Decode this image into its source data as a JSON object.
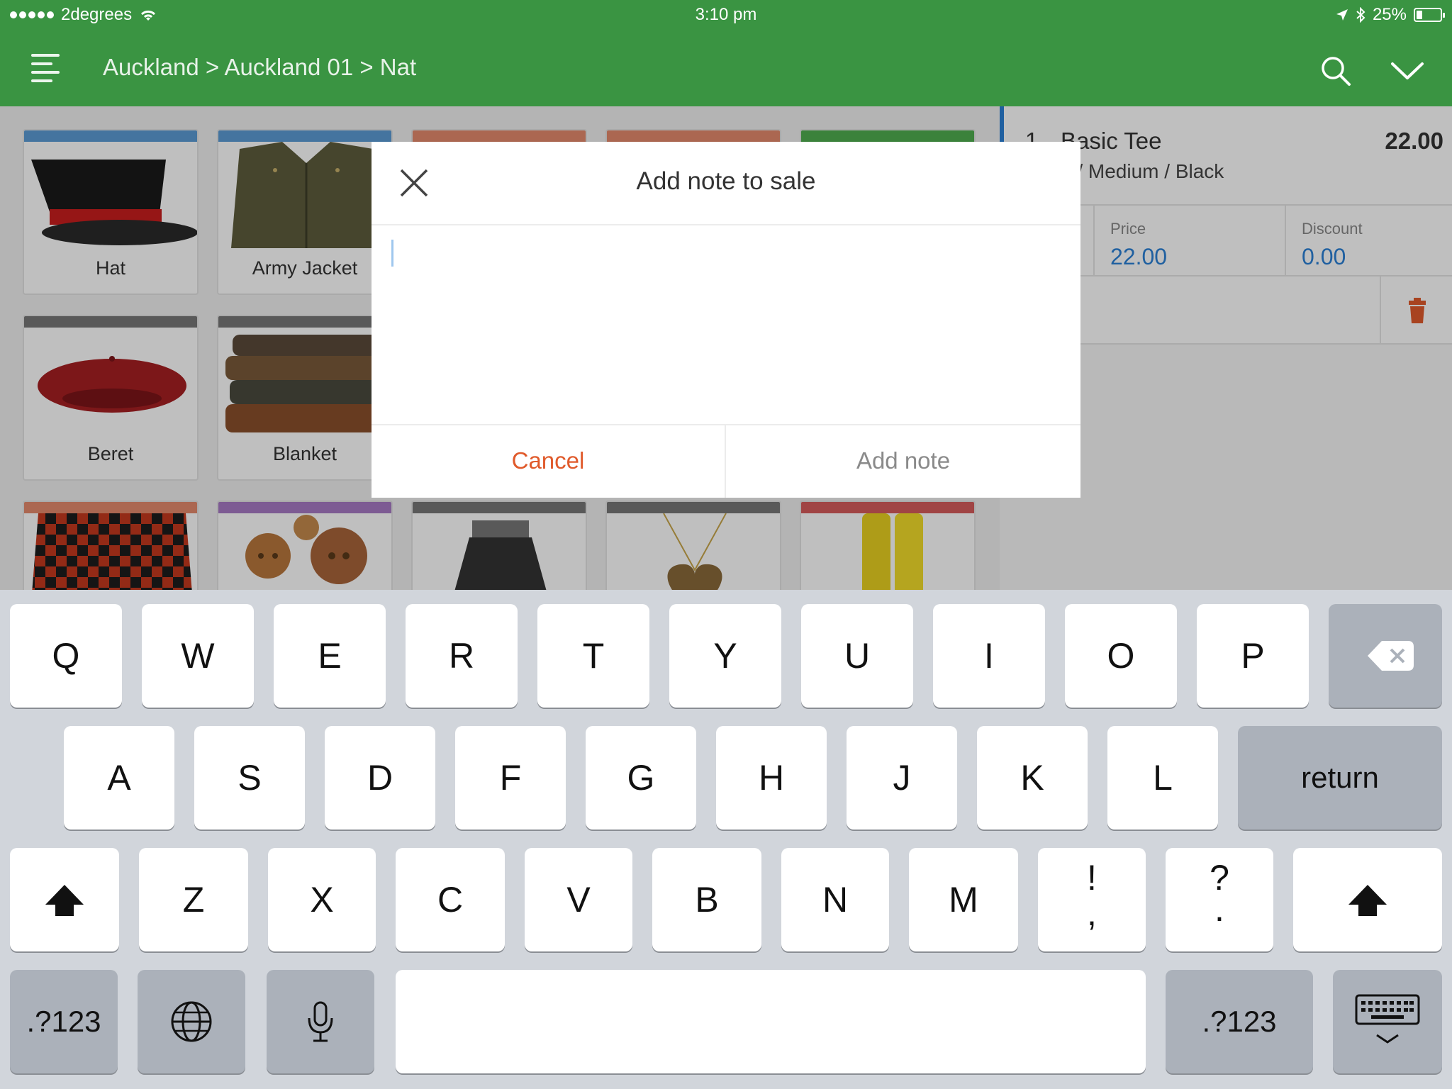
{
  "status_bar": {
    "carrier": "2degrees",
    "time": "3:10 pm",
    "battery": "25%",
    "battery_level": 0.25
  },
  "header": {
    "breadcrumb": "Auckland > Auckland 01 > Nat",
    "icons": [
      "menu-icon",
      "search-icon",
      "chevron-down-icon"
    ]
  },
  "products": [
    {
      "name": "Hat",
      "color": "#5b9bd5"
    },
    {
      "name": "Army Jacket",
      "color": "#5b9bd5"
    },
    {
      "name": "",
      "color": "#e58a6c"
    },
    {
      "name": "",
      "color": "#e58a6c"
    },
    {
      "name": "",
      "color": "#4fae4f"
    },
    {
      "name": "Beret",
      "color": "#777777"
    },
    {
      "name": "Blanket",
      "color": "#777777"
    },
    {
      "name": "",
      "color": "#e58a6c"
    },
    {
      "name": "",
      "color": "#a77ac4"
    },
    {
      "name": "",
      "color": "#777777"
    },
    {
      "name": "",
      "color": "#777777"
    },
    {
      "name": "",
      "color": "#d65b5b"
    }
  ],
  "sale": {
    "qty": "1",
    "item_name": "Basic Tee",
    "variant": "n / Medium / Black",
    "total": "22.00",
    "price_label": "Price",
    "price": "22.00",
    "discount_label": "Discount",
    "discount": "0.00"
  },
  "modal": {
    "title": "Add note to sale",
    "note_value": "",
    "cancel_label": "Cancel",
    "add_label": "Add note"
  },
  "keyboard": {
    "row1": [
      "Q",
      "W",
      "E",
      "R",
      "T",
      "Y",
      "U",
      "I",
      "O",
      "P"
    ],
    "row2": [
      "A",
      "S",
      "D",
      "F",
      "G",
      "H",
      "J",
      "K",
      "L"
    ],
    "return_label": "return",
    "row3": [
      "Z",
      "X",
      "C",
      "V",
      "B",
      "N",
      "M"
    ],
    "punct1_top": "!",
    "punct1_bottom": ",",
    "punct2_top": "?",
    "punct2_bottom": ".",
    "numbers_label": ".?123",
    "colors": {
      "accent": "#3a9442",
      "link": "#2b80d6",
      "cancel": "#e05a2b"
    }
  }
}
